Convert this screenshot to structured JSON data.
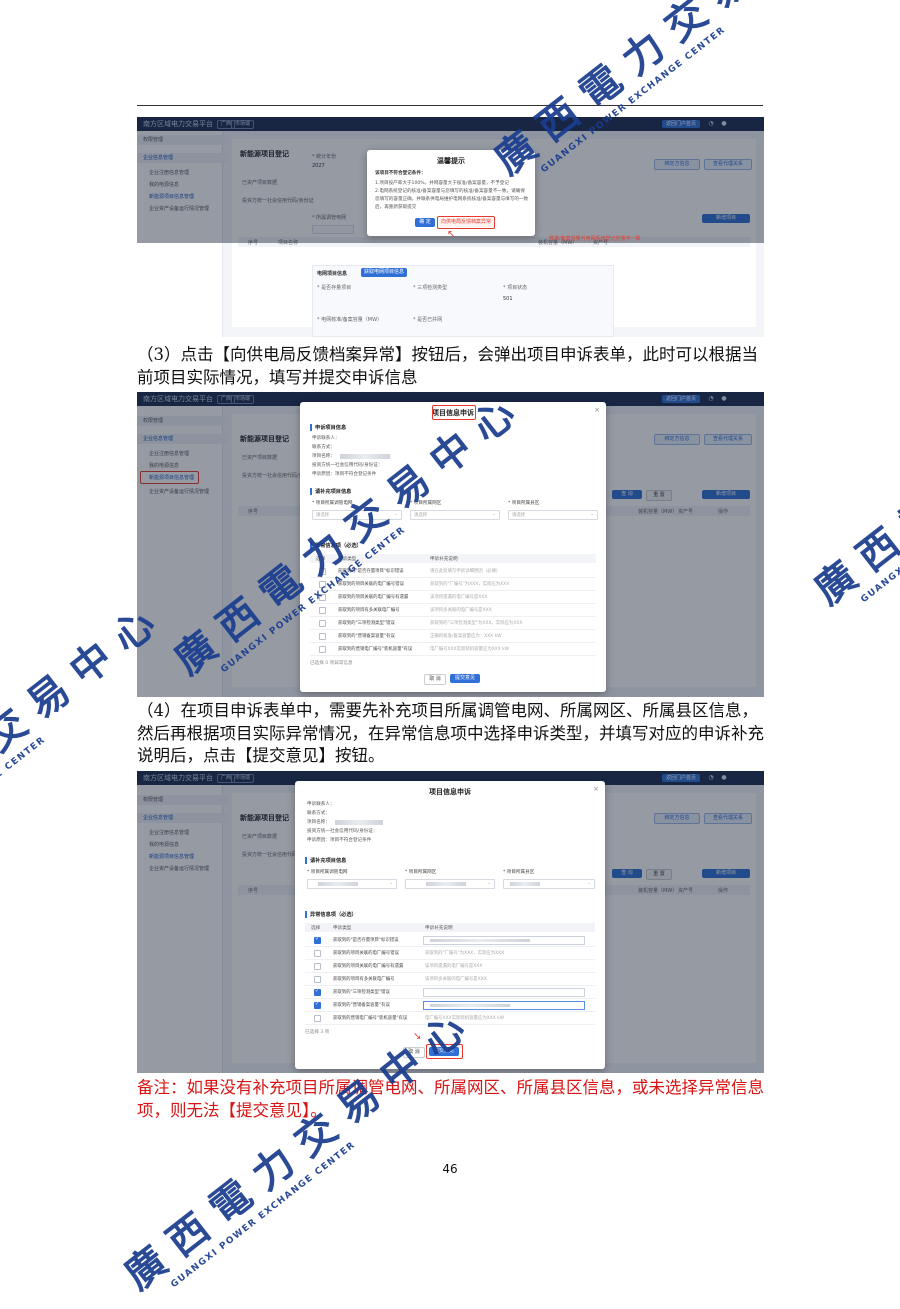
{
  "page_number": "46",
  "step3_text": "（3）点击【向供电局反馈档案异常】按钮后，会弹出项目申诉表单，此时可以根据当前项目实际情况，填写并提交申诉信息",
  "step4_text": "（4）在项目申诉表单中，需要先补充项目所属调管电网、所属网区、所属县区信息，然后再根据项目实际异常情况，在异常信息项中选择申诉类型，并填写对应的申诉补充说明后，点击【提交意见】按钮。",
  "note_text": "备注：如果没有补充项目所属调管电网、所属网区、所属县区信息，或未选择异常信息项，则无法【提交意见】。",
  "watermark": {
    "cn": "廣西電力交易中心",
    "en": "GUANGXI POWER EXCHANGE CENTER"
  },
  "app": {
    "brand": "南方区域电力交易平台",
    "brand_suffix": "广西",
    "region_tag": "市场端",
    "top_button": "返回门户首页",
    "sidebar": {
      "items": [
        "权限管理",
        "企业信息管理",
        "企业注册信息管理",
        "我的电源信息",
        "新能源项目信息管理",
        "企业资产设备运行情况管理"
      ]
    },
    "page_title": "新能源项目登记",
    "btn_bind": "绑定方信息",
    "btn_agent": "查看代理关系",
    "btn_query": "查 询",
    "btn_reset": "重 置",
    "btn_add": "新增项目",
    "tabs": [
      "已资产项目数据",
      "投资方统一社会信用代码/身份证"
    ],
    "table_cols": [
      "序号",
      "项目名称",
      "装机容量（MW）",
      "资产号",
      "操作"
    ]
  },
  "shot1": {
    "form": {
      "year_label": "* 统计年份",
      "year_value": "2027",
      "grid_label": "* 所属调管电网",
      "section_grid": "电网项目信息",
      "btn_grid_fetch": "获取电网项目信息",
      "f1": "* 是否存量项目",
      "f2": "* 三项检测类型",
      "f3": "* 项目状态",
      "f3_value": "501",
      "f4": "* 电网核准/备案容量（MW）",
      "f5": "* 是否已并网"
    },
    "dialog": {
      "title": "温馨提示",
      "intro": "该项目不符合登记条件：",
      "lines": [
        "1.项目投产率大于100%，并网容量大于核准/备案容量，不予登记",
        "2.电网系统登记的核准/备案容量与您填写的核准/备案容量不一致，请确保",
        "您填写的容量正确，并联系供电局维护电网系统核准/备案容量与填写的一致",
        "后，再重新获取提交"
      ],
      "ok": "确 定",
      "feedback": "向供电局反馈档案异常"
    },
    "side_note": "核准/备案容量与电网系统登记容量不一致"
  },
  "shot2": {
    "dialog": {
      "title": "项目信息申诉",
      "sec_applicant": "申诉项目信息",
      "applicant_lines": [
        "申诉联系人：",
        "联系方式：",
        "项目名称：",
        "投资方统一社会信用代码/身份证：",
        "申诉原因：项目不符合登记条件"
      ],
      "sec_supplement": "请补充项目信息",
      "field_grid": "* 项目所属调管电网",
      "field_area": "* 项目所属网区",
      "field_county": "* 项目所属县区",
      "placeholder": "请选择",
      "sec_abnormal": "异常信息项（必选）",
      "col_select": "选择",
      "col_type": "申诉类型",
      "col_desc": "申诉补充说明",
      "rows": [
        {
          "type": "获取到的\"是否存量项目\"标识错误",
          "desc": "请在此处填写申诉详细原因（必填）"
        },
        {
          "type": "获取到的项目关联的电厂编号错误",
          "desc": "获取到的\"厂编号\"为XXX，实际应为XXX"
        },
        {
          "type": "获取到的项目关联的电厂编号有遗漏",
          "desc": "该项目遗漏的电厂编号是XXX"
        },
        {
          "type": "获取到的项目有多关联电厂编号",
          "desc": "该项目多关联的电厂编号是XXX"
        },
        {
          "type": "获取到的\"三项检测类型\"错误",
          "desc": "获取到的\"三项检测类型\"为XXX，实际应为XXX"
        },
        {
          "type": "获取到的\"营销备案容量\"有误",
          "desc": "正确的核准/备案容量应为：XXX kW"
        },
        {
          "type": "获取到的营销电厂编号\"装机容量\"有误",
          "desc": "电厂编号XXX实际装机容量应为XXX kW"
        }
      ],
      "selected_count": "已选择 0 项异常信息",
      "cancel": "取 消",
      "submit": "提交意见"
    }
  },
  "shot3": {
    "dialog": {
      "title": "项目信息申诉",
      "applicant_lines": [
        "申诉联系人：",
        "联系方式：",
        "项目名称：",
        "投资方统一社会信用代码/身份证：",
        "申诉原因：项目不符合登记条件"
      ],
      "sec_supplement": "请补充项目信息",
      "field_grid": "* 项目所属调管电网",
      "field_area": "* 项目所属网区",
      "field_county": "* 项目所属县区",
      "sec_abnormal": "异常信息项（必选）",
      "col_select": "选择",
      "col_type": "申诉类型",
      "col_desc": "申诉补充说明",
      "rows": [
        {
          "type": "获取到的\"是否存量项目\"标识错误",
          "desc": "",
          "checked": true
        },
        {
          "type": "获取到的项目关联的电厂编号错误",
          "desc": "获取到的\"厂编号\"为XXX，实际应为XXX",
          "checked": false
        },
        {
          "type": "获取到的项目关联的电厂编号有遗漏",
          "desc": "该项目遗漏的电厂编号是XXX",
          "checked": false
        },
        {
          "type": "获取到的项目有多关联电厂编号",
          "desc": "该项目多关联的电厂编号是XXX",
          "checked": false
        },
        {
          "type": "获取到的\"三项检测类型\"错误",
          "desc": "",
          "checked": true
        },
        {
          "type": "获取到的\"营销备案容量\"有误",
          "desc": "",
          "checked": true
        },
        {
          "type": "获取到的营销电厂编号\"装机容量\"有误",
          "desc": "电厂编号XXX实际装机容量应为XXX kW",
          "checked": false
        }
      ],
      "selected_count": "已选择 3 项",
      "cancel": "取 消",
      "submit": "提交意见"
    }
  },
  "colors": {
    "nav": "#1c2d52",
    "primary": "#2f6fd6",
    "highlight": "#e8392c",
    "note": "#d81414",
    "watermark": "#1a3d8f"
  }
}
